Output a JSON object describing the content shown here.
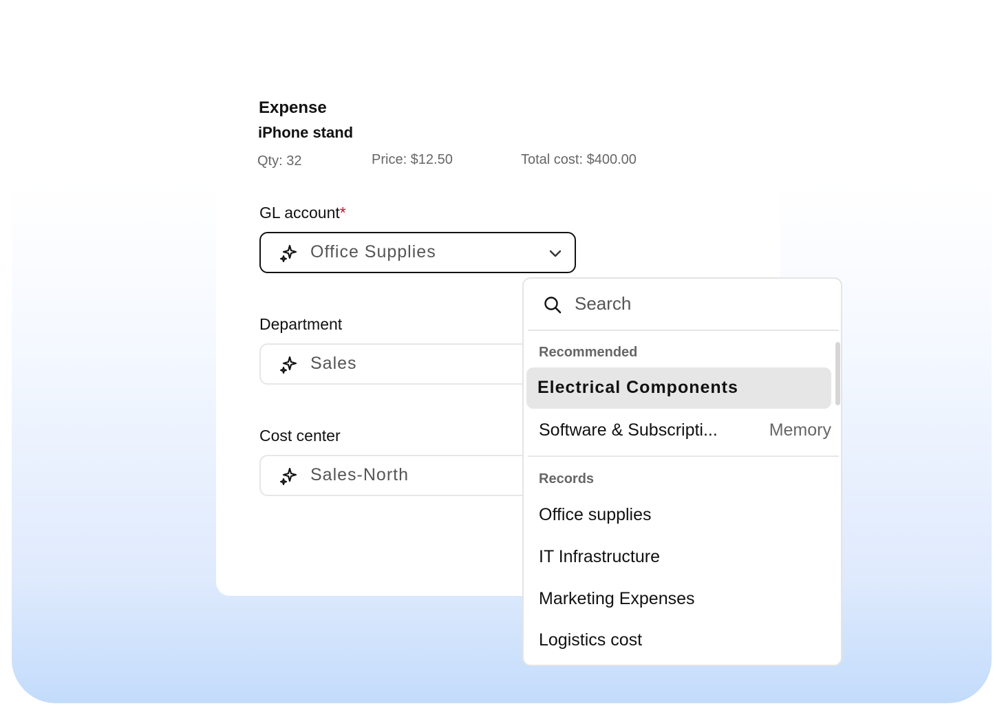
{
  "expense": {
    "heading": "Expense",
    "item_name": "iPhone stand",
    "qty": "Qty: 32",
    "price": "Price: $12.50",
    "total": "Total cost: $400.00"
  },
  "gl_account": {
    "label": "GL account",
    "required_mark": "*",
    "value": "Office Supplies"
  },
  "department": {
    "label": "Department",
    "value": "Sales"
  },
  "cost_center": {
    "label": "Cost center",
    "value": "Sales-North"
  },
  "dropdown": {
    "search_placeholder": "Search",
    "recommended_title": "Recommended",
    "recommended": [
      {
        "label": "Electrical Components",
        "tag": ""
      },
      {
        "label": "Software & Subscripti...",
        "tag": "Memory"
      }
    ],
    "records_title": "Records",
    "records": [
      "Office supplies",
      "IT Infrastructure",
      "Marketing Expenses",
      "Logistics cost"
    ]
  }
}
